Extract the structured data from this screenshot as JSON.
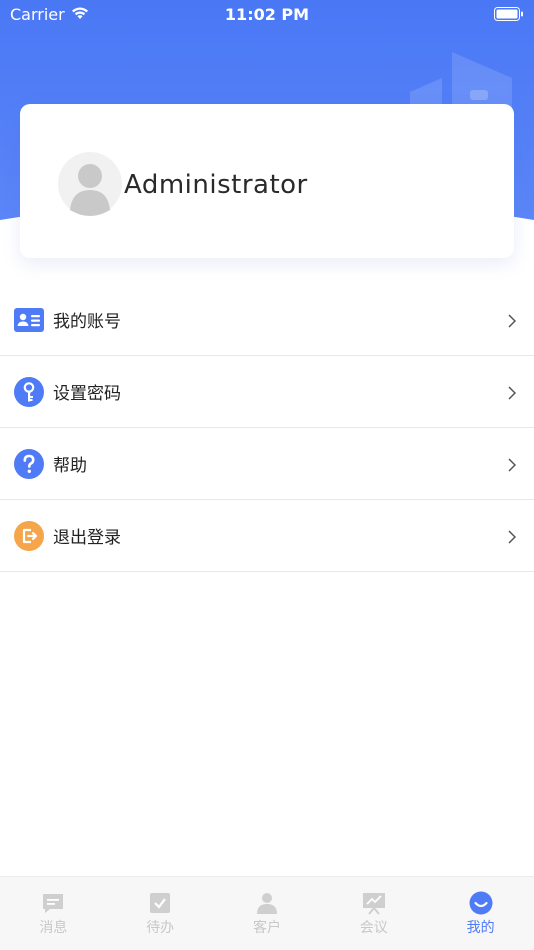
{
  "status_bar": {
    "carrier": "Carrier",
    "time": "11:02 PM"
  },
  "profile": {
    "name": "Administrator"
  },
  "menu": {
    "items": [
      {
        "label": "我的账号",
        "icon": "id-card-icon",
        "color": "#4f7bf7"
      },
      {
        "label": "设置密码",
        "icon": "key-icon",
        "color": "#4f7bf7"
      },
      {
        "label": "帮助",
        "icon": "help-icon",
        "color": "#4f7bf7"
      },
      {
        "label": "退出登录",
        "icon": "logout-icon",
        "color": "#f5a54a"
      }
    ]
  },
  "tabs": [
    {
      "label": "消息",
      "icon": "message-icon",
      "active": false
    },
    {
      "label": "待办",
      "icon": "todo-icon",
      "active": false
    },
    {
      "label": "客户",
      "icon": "customer-icon",
      "active": false
    },
    {
      "label": "会议",
      "icon": "meeting-icon",
      "active": false
    },
    {
      "label": "我的",
      "icon": "mine-icon",
      "active": true
    }
  ],
  "colors": {
    "brand": "#4f7bf7",
    "logout": "#f5a54a",
    "tab_inactive": "#c8c8c8"
  }
}
